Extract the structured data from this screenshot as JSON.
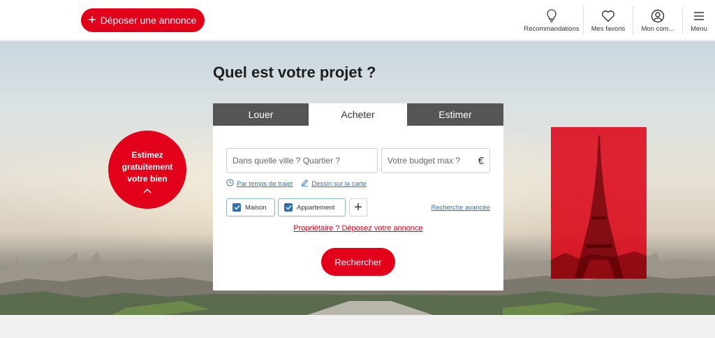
{
  "header": {
    "post_button_label": "Déposer une annonce",
    "nav": {
      "recommendations": "Recommandations",
      "favorites": "Mes favoris",
      "account": "Mon com...",
      "menu": "Menu"
    }
  },
  "hero": {
    "title": "Quel est votre projet ?",
    "estimate": {
      "line1": "Estimez",
      "line2": "gratuitement",
      "line3": "votre bien",
      "caret": "^"
    }
  },
  "search": {
    "tabs": [
      "Louer",
      "Acheter",
      "Estimer"
    ],
    "active_tab": "Acheter",
    "city_placeholder": "Dans quelle ville ? Quartier ?",
    "budget_placeholder": "Votre budget max ?",
    "currency": "€",
    "links": {
      "travel_time": "Par temps de trajet",
      "draw_map": "Dessin sur la carte",
      "advanced": "Recherche avancée"
    },
    "property_types": [
      {
        "label": "Maison",
        "checked": true
      },
      {
        "label": "Appartement",
        "checked": true
      }
    ],
    "add_symbol": "+",
    "owner_link": "Propriétaire ? Déposez votre annonce",
    "search_button": "Rechercher"
  },
  "colors": {
    "brand_red": "#e3001b",
    "link_blue": "#2e6eb5",
    "tab_inactive": "#555555"
  },
  "icons": [
    "plus-icon",
    "lightbulb-icon",
    "heart-icon",
    "user-circle-icon",
    "hamburger-icon",
    "clock-icon",
    "pencil-icon",
    "checkbox-icon",
    "chevron-up-icon"
  ]
}
